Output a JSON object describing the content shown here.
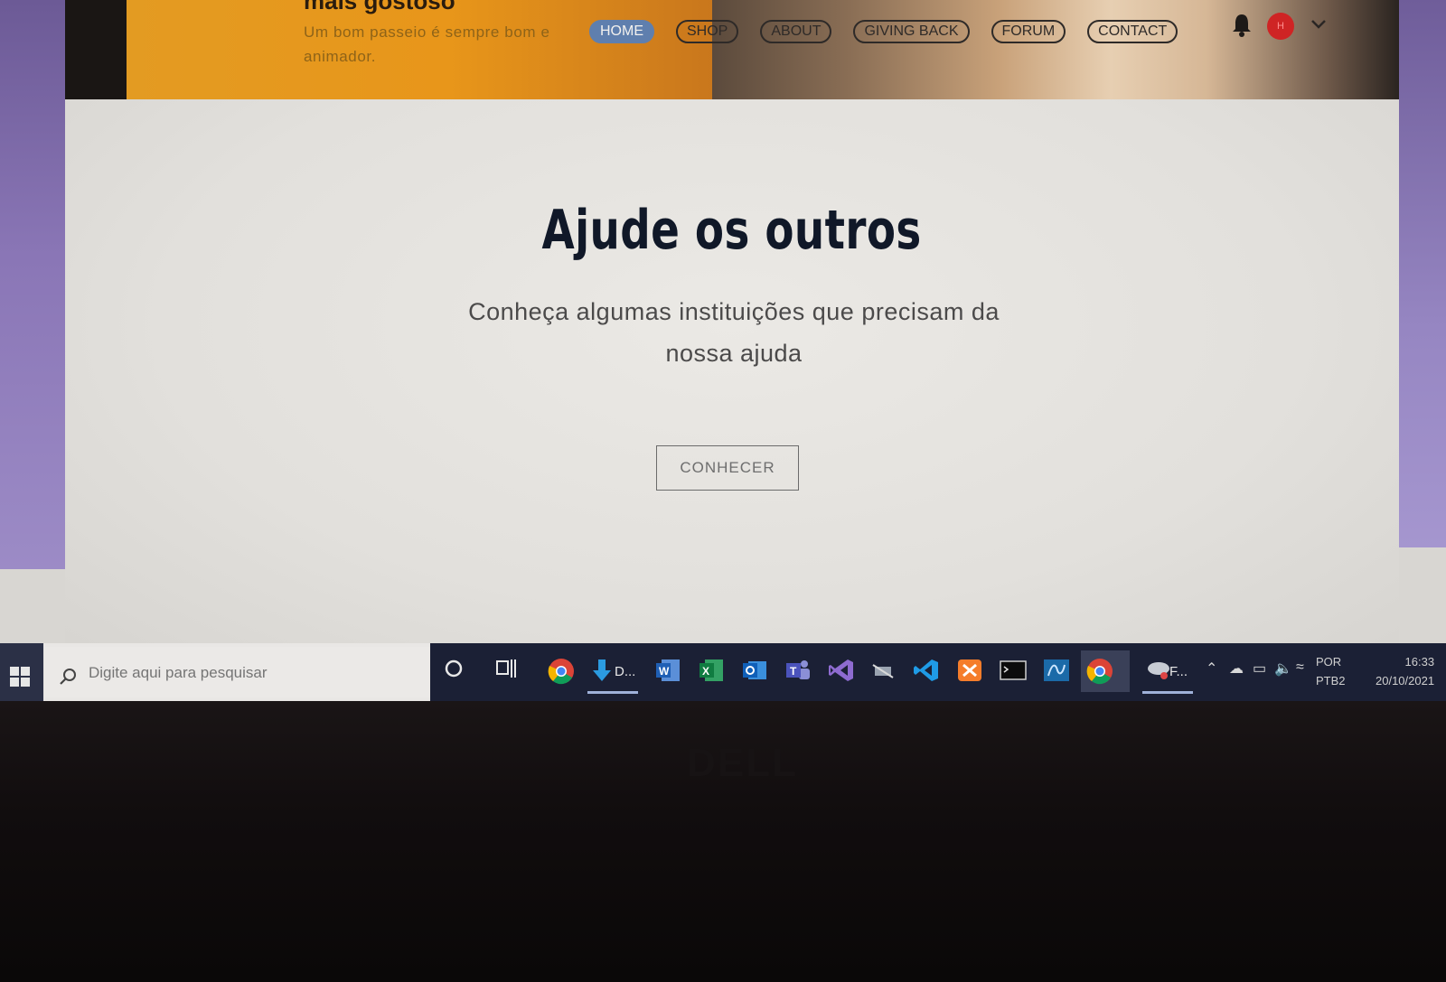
{
  "site": {
    "hero_title": "mais gostoso",
    "hero_subtitle": "Um bom passeio é sempre bom e animador.",
    "nav": [
      "HOME",
      "SHOP",
      "ABOUT",
      "GIVING BACK",
      "FORUM",
      "CONTACT"
    ],
    "avatar_initial": "H",
    "headline": "Ajude os outros",
    "subtitle": "Conheça algumas instituições que precisam da nossa ajuda",
    "cta_label": "CONHECER"
  },
  "taskbar": {
    "search_placeholder": "Digite aqui para pesquisar",
    "download_label": "D...",
    "last_app_label": "F...",
    "lang_line1": "POR",
    "lang_line2": "PTB2",
    "time": "16:33",
    "date": "20/10/2021"
  },
  "device": {
    "brand": "DELL"
  },
  "colors": {
    "hero_orange": "#e8961a",
    "nav_active": "#5f7fae",
    "headline": "#101828",
    "taskbar": "#1b2035",
    "accent_purple": "#8a76b6"
  },
  "icons": [
    "bell-icon",
    "chevron-down-icon",
    "windows-start-icon",
    "search-icon",
    "cortana-icon",
    "task-view-icon",
    "chrome-icon",
    "download-icon",
    "word-icon",
    "excel-icon",
    "outlook-icon",
    "teams-icon",
    "visual-studio-icon",
    "vscode-icon",
    "xampp-icon",
    "terminal-icon",
    "sql-icon"
  ]
}
